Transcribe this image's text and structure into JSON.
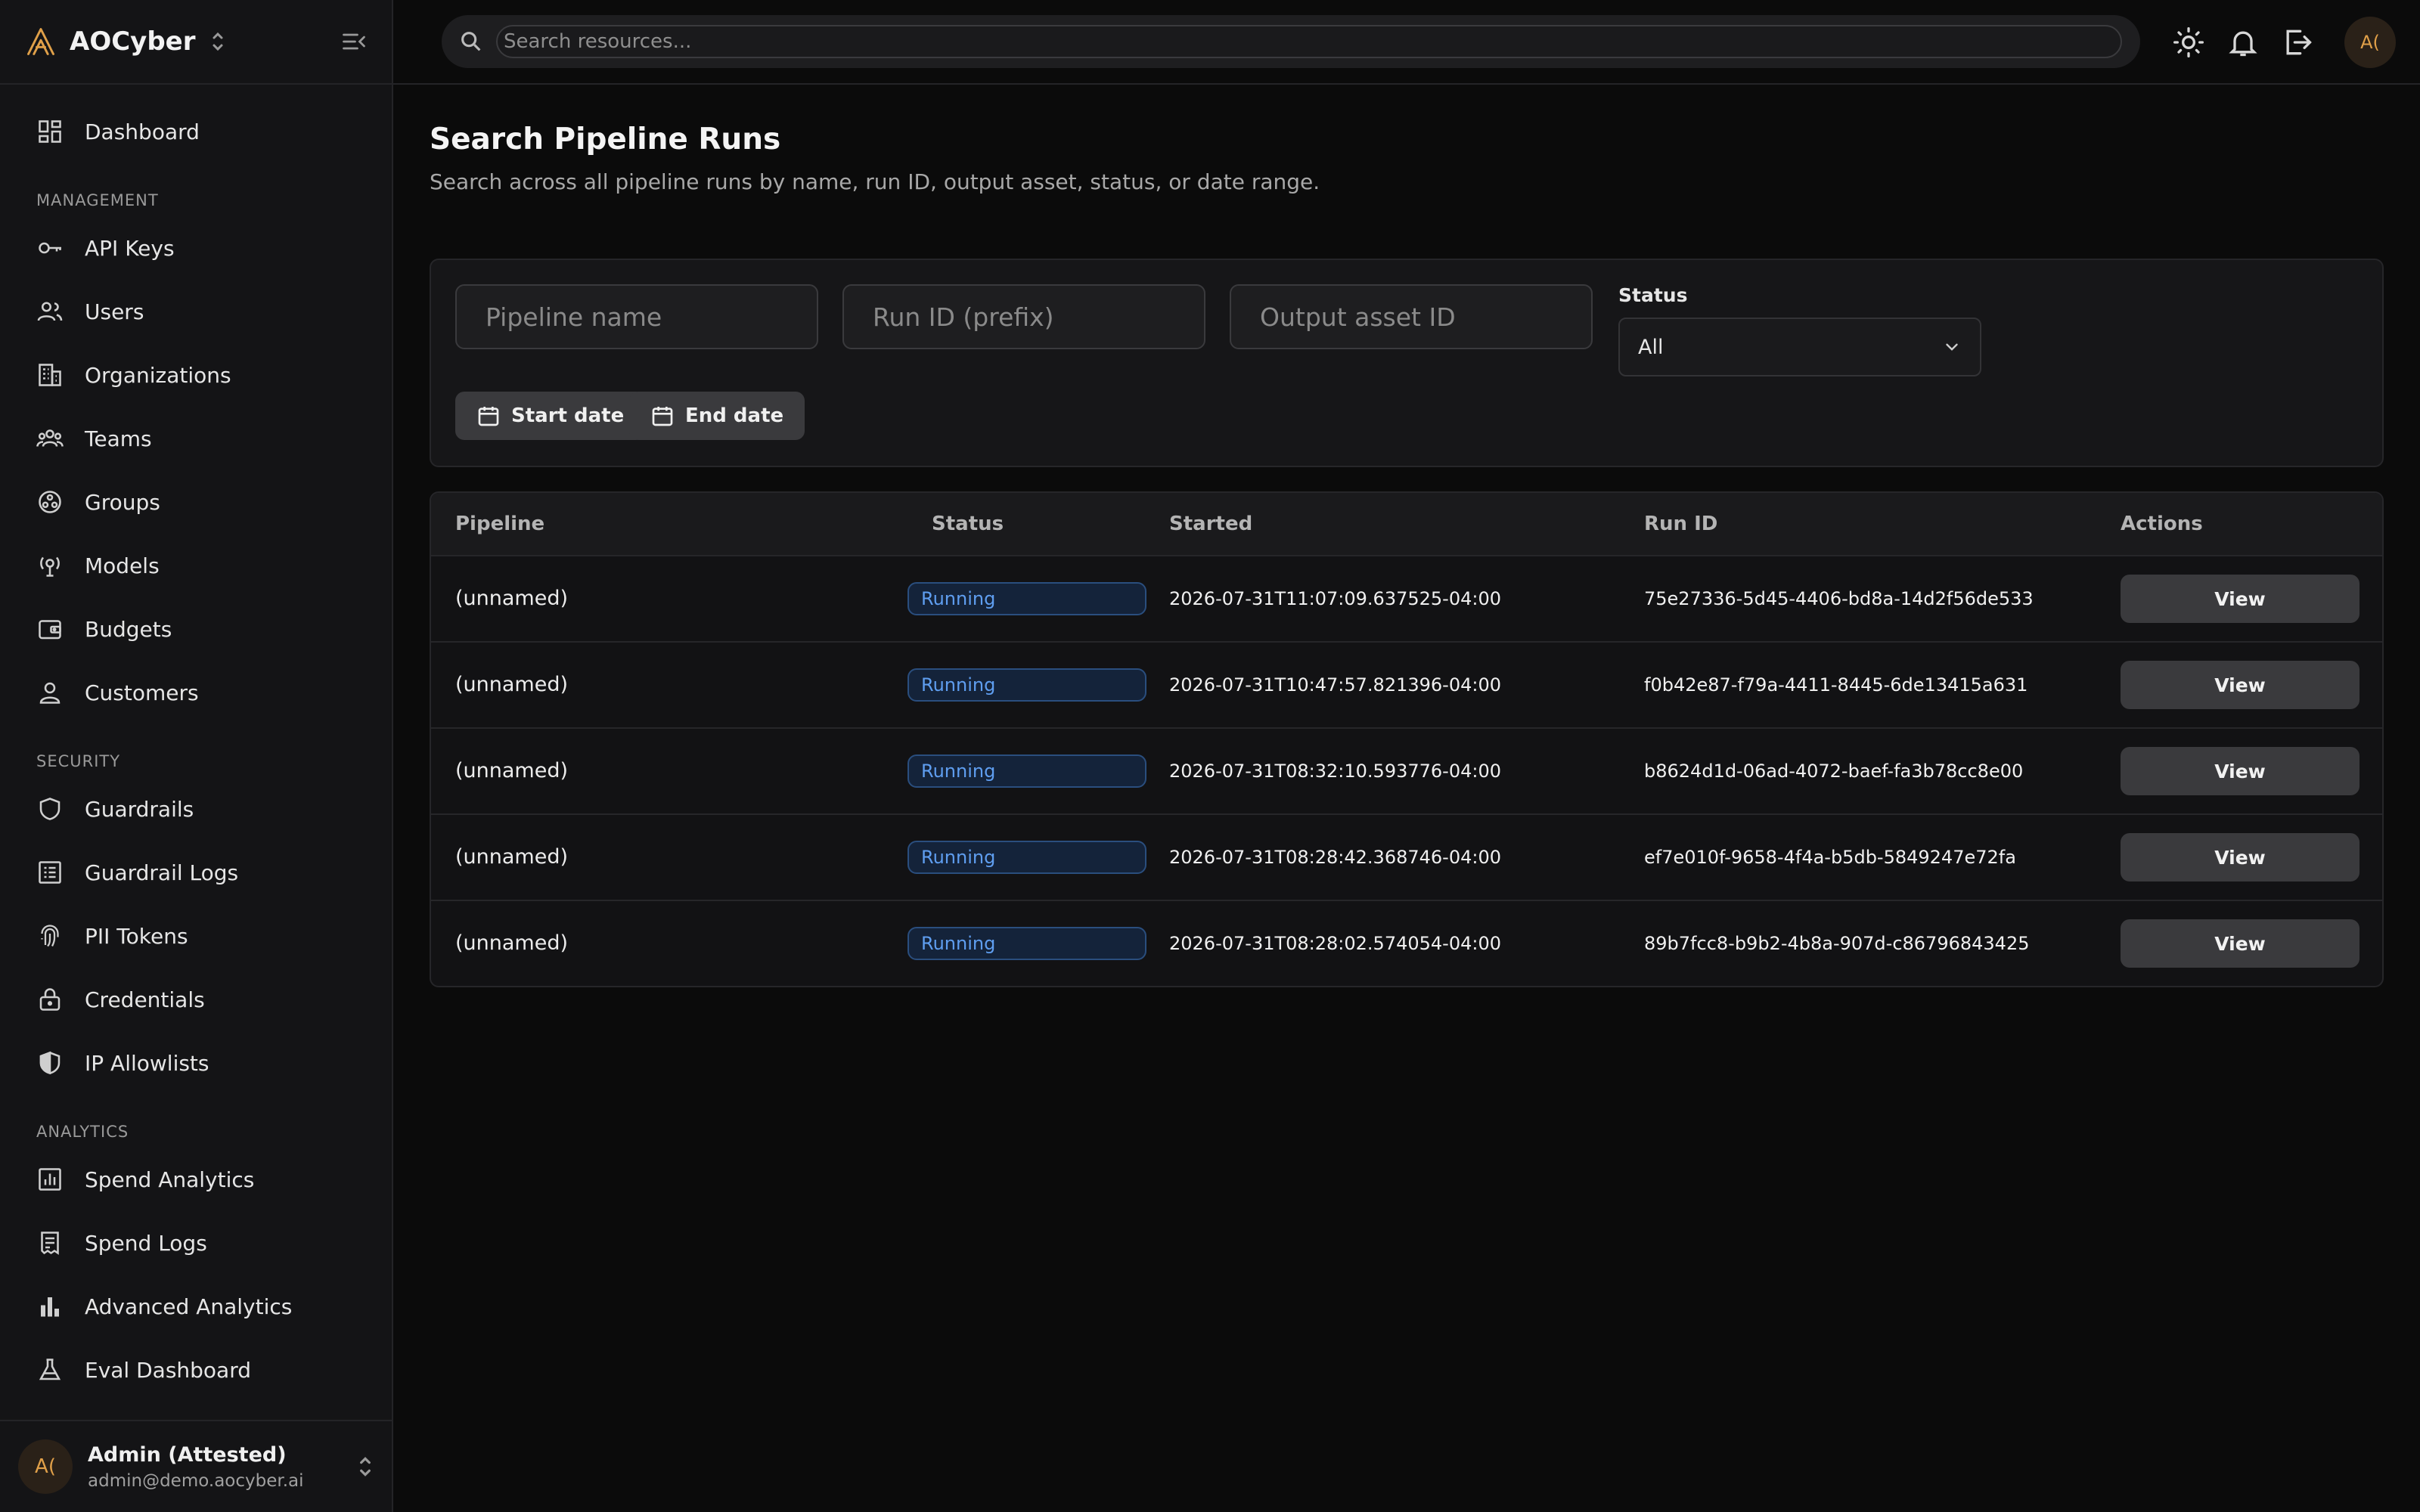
{
  "app": {
    "brand": "AOCyber"
  },
  "sidebar": {
    "dashboard": "Dashboard",
    "sections": [
      {
        "title": "MANAGEMENT",
        "items": [
          "API Keys",
          "Users",
          "Organizations",
          "Teams",
          "Groups",
          "Models",
          "Budgets",
          "Customers"
        ]
      },
      {
        "title": "SECURITY",
        "items": [
          "Guardrails",
          "Guardrail Logs",
          "PII Tokens",
          "Credentials",
          "IP Allowlists"
        ]
      },
      {
        "title": "ANALYTICS",
        "items": [
          "Spend Analytics",
          "Spend Logs",
          "Advanced Analytics",
          "Eval Dashboard"
        ]
      }
    ],
    "user": {
      "initials": "A(",
      "name": "Admin (Attested)",
      "email": "admin@demo.aocyber.ai"
    }
  },
  "topbar": {
    "search_placeholder": "Search resources...",
    "avatar_initials": "A("
  },
  "page": {
    "title": "Search Pipeline Runs",
    "subtitle": "Search across all pipeline runs by name, run ID, output asset, status, or date range."
  },
  "filters": {
    "pipeline_name_placeholder": "Pipeline name",
    "run_id_placeholder": "Run ID (prefix)",
    "output_asset_placeholder": "Output asset ID",
    "status_label": "Status",
    "status_value": "All",
    "start_date": "Start date",
    "end_date": "End date"
  },
  "table": {
    "headers": {
      "pipeline": "Pipeline",
      "status": "Status",
      "started": "Started",
      "run_id": "Run ID",
      "actions": "Actions"
    },
    "rows": [
      {
        "pipeline": "(unnamed)",
        "status": "Running",
        "started": "2026-07-31T11:07:09.637525-04:00",
        "run_id": "75e27336-5d45-4406-bd8a-14d2f56de533",
        "action": "View"
      },
      {
        "pipeline": "(unnamed)",
        "status": "Running",
        "started": "2026-07-31T10:47:57.821396-04:00",
        "run_id": "f0b42e87-f79a-4411-8445-6de13415a631",
        "action": "View"
      },
      {
        "pipeline": "(unnamed)",
        "status": "Running",
        "started": "2026-07-31T08:32:10.593776-04:00",
        "run_id": "b8624d1d-06ad-4072-baef-fa3b78cc8e00",
        "action": "View"
      },
      {
        "pipeline": "(unnamed)",
        "status": "Running",
        "started": "2026-07-31T08:28:42.368746-04:00",
        "run_id": "ef7e010f-9658-4f4a-b5db-5849247e72fa",
        "action": "View"
      },
      {
        "pipeline": "(unnamed)",
        "status": "Running",
        "started": "2026-07-31T08:28:02.574054-04:00",
        "run_id": "89b7fcc8-b9b2-4b8a-907d-c86796843425",
        "action": "View"
      }
    ]
  }
}
